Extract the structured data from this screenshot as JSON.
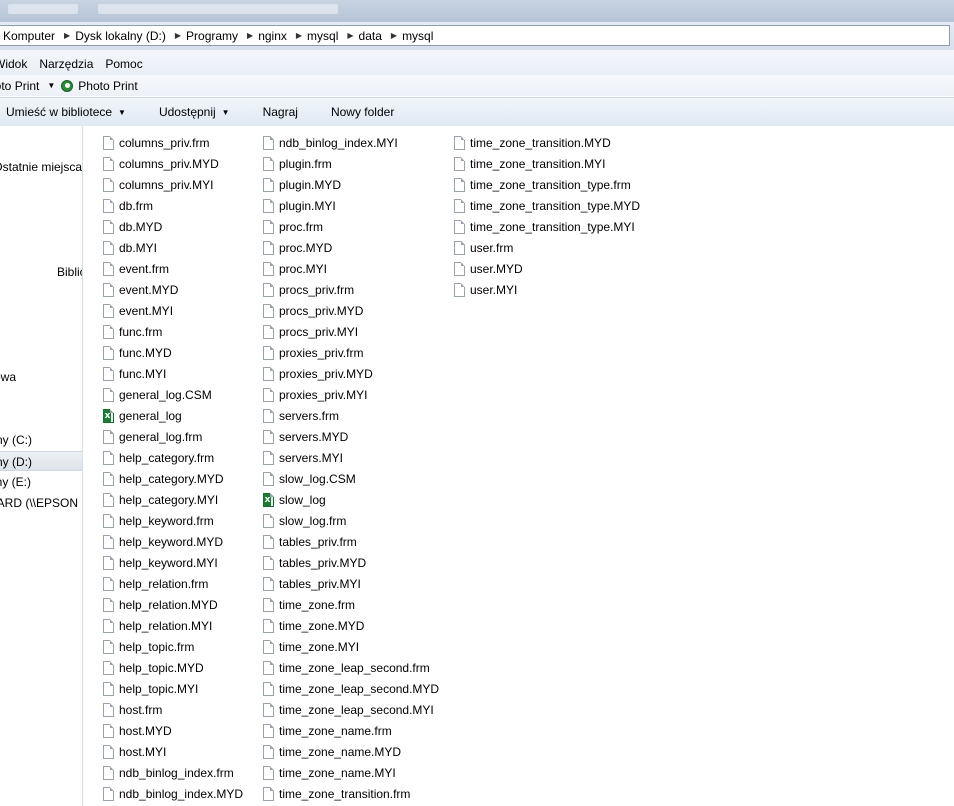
{
  "breadcrumb": [
    "Komputer",
    "Dysk lokalny (D:)",
    "Programy",
    "nginx",
    "mysql",
    "data",
    "mysql"
  ],
  "menu": [
    "Widok",
    "Narzędzia",
    "Pomoc"
  ],
  "photobar": {
    "item1": "Photo Print",
    "item2": "Photo Print"
  },
  "commands": [
    "Umieść w bibliotece",
    "Udostępnij",
    "Nagraj",
    "Nowy folder"
  ],
  "nav": {
    "items": [
      "Ostatnie miejsca",
      "Biblioteki",
      "Grupa domowa",
      "Dysk lokalny (C:)",
      "Dysk lokalny (D:)",
      "Dysk lokalny (E:)",
      "CARD (\\\\EPSON"
    ],
    "selected": "Dysk lokalny (D:)"
  },
  "columns": [
    [
      {
        "name": "columns_priv.frm",
        "icon": "file-icon"
      },
      {
        "name": "columns_priv.MYD",
        "icon": "file-icon"
      },
      {
        "name": "columns_priv.MYI",
        "icon": "file-icon"
      },
      {
        "name": "db.frm",
        "icon": "file-icon"
      },
      {
        "name": "db.MYD",
        "icon": "file-icon"
      },
      {
        "name": "db.MYI",
        "icon": "file-icon"
      },
      {
        "name": "event.frm",
        "icon": "file-icon"
      },
      {
        "name": "event.MYD",
        "icon": "file-icon"
      },
      {
        "name": "event.MYI",
        "icon": "file-icon"
      },
      {
        "name": "func.frm",
        "icon": "file-icon"
      },
      {
        "name": "func.MYD",
        "icon": "file-icon"
      },
      {
        "name": "func.MYI",
        "icon": "file-icon"
      },
      {
        "name": "general_log.CSM",
        "icon": "file-icon"
      },
      {
        "name": "general_log",
        "icon": "excel-csv-icon"
      },
      {
        "name": "general_log.frm",
        "icon": "file-icon"
      },
      {
        "name": "help_category.frm",
        "icon": "file-icon"
      },
      {
        "name": "help_category.MYD",
        "icon": "file-icon"
      },
      {
        "name": "help_category.MYI",
        "icon": "file-icon"
      },
      {
        "name": "help_keyword.frm",
        "icon": "file-icon"
      },
      {
        "name": "help_keyword.MYD",
        "icon": "file-icon"
      },
      {
        "name": "help_keyword.MYI",
        "icon": "file-icon"
      },
      {
        "name": "help_relation.frm",
        "icon": "file-icon"
      },
      {
        "name": "help_relation.MYD",
        "icon": "file-icon"
      },
      {
        "name": "help_relation.MYI",
        "icon": "file-icon"
      },
      {
        "name": "help_topic.frm",
        "icon": "file-icon"
      },
      {
        "name": "help_topic.MYD",
        "icon": "file-icon"
      },
      {
        "name": "help_topic.MYI",
        "icon": "file-icon"
      },
      {
        "name": "host.frm",
        "icon": "file-icon"
      },
      {
        "name": "host.MYD",
        "icon": "file-icon"
      },
      {
        "name": "host.MYI",
        "icon": "file-icon"
      },
      {
        "name": "ndb_binlog_index.frm",
        "icon": "file-icon"
      },
      {
        "name": "ndb_binlog_index.MYD",
        "icon": "file-icon"
      }
    ],
    [
      {
        "name": "ndb_binlog_index.MYI",
        "icon": "file-icon"
      },
      {
        "name": "plugin.frm",
        "icon": "file-icon"
      },
      {
        "name": "plugin.MYD",
        "icon": "file-icon"
      },
      {
        "name": "plugin.MYI",
        "icon": "file-icon"
      },
      {
        "name": "proc.frm",
        "icon": "file-icon"
      },
      {
        "name": "proc.MYD",
        "icon": "file-icon"
      },
      {
        "name": "proc.MYI",
        "icon": "file-icon"
      },
      {
        "name": "procs_priv.frm",
        "icon": "file-icon"
      },
      {
        "name": "procs_priv.MYD",
        "icon": "file-icon"
      },
      {
        "name": "procs_priv.MYI",
        "icon": "file-icon"
      },
      {
        "name": "proxies_priv.frm",
        "icon": "file-icon"
      },
      {
        "name": "proxies_priv.MYD",
        "icon": "file-icon"
      },
      {
        "name": "proxies_priv.MYI",
        "icon": "file-icon"
      },
      {
        "name": "servers.frm",
        "icon": "file-icon"
      },
      {
        "name": "servers.MYD",
        "icon": "file-icon"
      },
      {
        "name": "servers.MYI",
        "icon": "file-icon"
      },
      {
        "name": "slow_log.CSM",
        "icon": "file-icon"
      },
      {
        "name": "slow_log",
        "icon": "excel-csv-icon"
      },
      {
        "name": "slow_log.frm",
        "icon": "file-icon"
      },
      {
        "name": "tables_priv.frm",
        "icon": "file-icon"
      },
      {
        "name": "tables_priv.MYD",
        "icon": "file-icon"
      },
      {
        "name": "tables_priv.MYI",
        "icon": "file-icon"
      },
      {
        "name": "time_zone.frm",
        "icon": "file-icon"
      },
      {
        "name": "time_zone.MYD",
        "icon": "file-icon"
      },
      {
        "name": "time_zone.MYI",
        "icon": "file-icon"
      },
      {
        "name": "time_zone_leap_second.frm",
        "icon": "file-icon"
      },
      {
        "name": "time_zone_leap_second.MYD",
        "icon": "file-icon"
      },
      {
        "name": "time_zone_leap_second.MYI",
        "icon": "file-icon"
      },
      {
        "name": "time_zone_name.frm",
        "icon": "file-icon"
      },
      {
        "name": "time_zone_name.MYD",
        "icon": "file-icon"
      },
      {
        "name": "time_zone_name.MYI",
        "icon": "file-icon"
      },
      {
        "name": "time_zone_transition.frm",
        "icon": "file-icon"
      }
    ],
    [
      {
        "name": "time_zone_transition.MYD",
        "icon": "file-icon"
      },
      {
        "name": "time_zone_transition.MYI",
        "icon": "file-icon"
      },
      {
        "name": "time_zone_transition_type.frm",
        "icon": "file-icon"
      },
      {
        "name": "time_zone_transition_type.MYD",
        "icon": "file-icon"
      },
      {
        "name": "time_zone_transition_type.MYI",
        "icon": "file-icon"
      },
      {
        "name": "user.frm",
        "icon": "file-icon"
      },
      {
        "name": "user.MYD",
        "icon": "file-icon"
      },
      {
        "name": "user.MYI",
        "icon": "file-icon"
      }
    ]
  ]
}
